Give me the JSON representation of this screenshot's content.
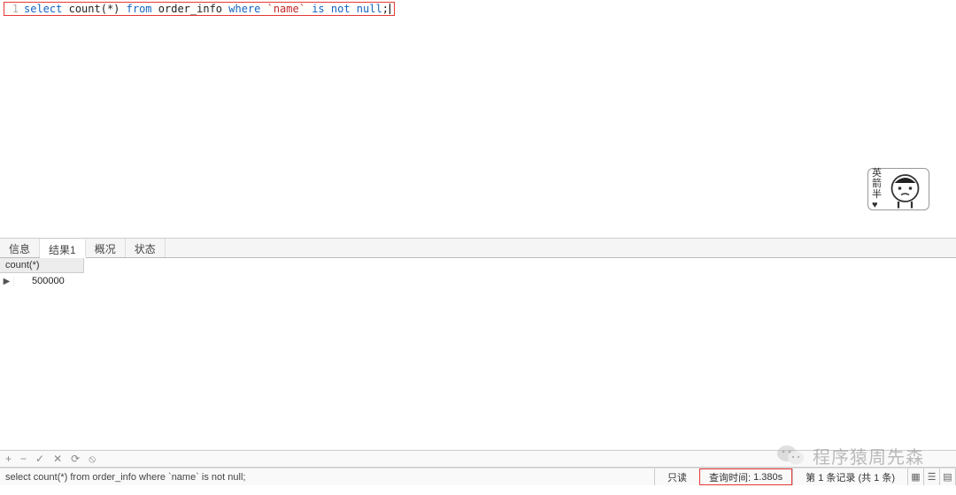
{
  "editor": {
    "line_number": "1",
    "tokens": {
      "select": "select",
      "count": "count(*)",
      "from": "from",
      "table": "order_info",
      "where": "where",
      "col": "`name`",
      "isnotnull": "is not null",
      "semi": ";"
    }
  },
  "sticker": {
    "l1": "英",
    "l2": "箭",
    "l3": "半",
    "heart": "♥"
  },
  "tabs": {
    "info": "信息",
    "result": "结果1",
    "profile": "概况",
    "status": "状态"
  },
  "grid": {
    "header": "count(*)",
    "row_marker": "▶",
    "value": "500000"
  },
  "toolbar": {
    "plus": "+",
    "minus": "−",
    "check": "✓",
    "cancel": "✕",
    "refresh": "⟳",
    "stop": "⦸"
  },
  "status": {
    "sql": "select count(*) from order_info where `name` is not null;",
    "readonly": "只读",
    "query_time_label": "查询时间:",
    "query_time_value": "1.380s",
    "records": "第 1 条记录 (共 1 条)"
  },
  "view_toggle": {
    "grid": "▦",
    "form": "☰",
    "text": "▤"
  },
  "watermark": {
    "text": "程序猿周先森"
  }
}
